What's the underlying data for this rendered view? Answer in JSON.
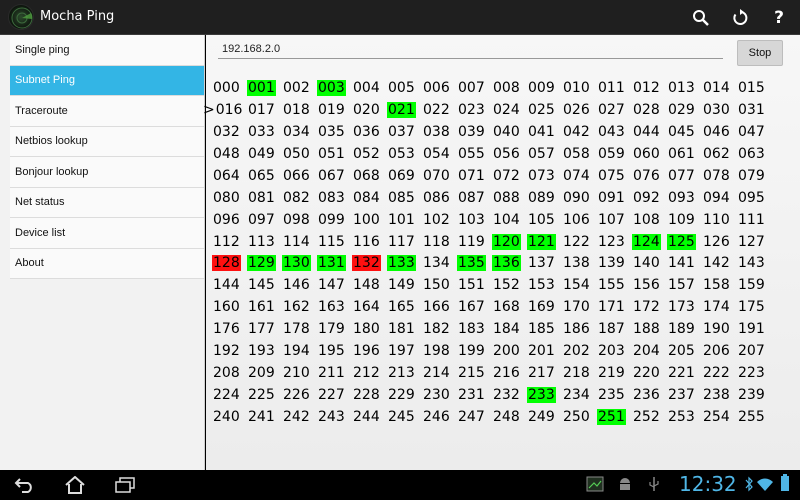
{
  "app": {
    "title": "Mocha Ping",
    "actions": [
      {
        "name": "search-icon"
      },
      {
        "name": "refresh-icon"
      },
      {
        "name": "help-icon",
        "label": "?"
      }
    ]
  },
  "sidebar": {
    "items": [
      {
        "label": "Single ping",
        "selected": false
      },
      {
        "label": "Subnet Ping",
        "selected": true
      },
      {
        "label": "Traceroute",
        "selected": false
      },
      {
        "label": "Netbios lookup",
        "selected": false
      },
      {
        "label": "Bonjour lookup",
        "selected": false
      },
      {
        "label": "Net status",
        "selected": false
      },
      {
        "label": "Device list",
        "selected": false
      },
      {
        "label": "About",
        "selected": false
      }
    ]
  },
  "main": {
    "ip_value": "192.168.2.0",
    "stop_label": "Stop",
    "current_marker": ">",
    "current_host": 16,
    "up_hosts": [
      1,
      3,
      21,
      120,
      121,
      124,
      125,
      129,
      130,
      131,
      133,
      135,
      136,
      233,
      251
    ],
    "down_hosts": [
      128,
      132
    ],
    "host_count": 256
  },
  "statusbar": {
    "clock": "12:32",
    "colors": {
      "accent": "#33b5e5",
      "up": "#00ff00",
      "down": "#ff1010",
      "clock": "#4fb6e6"
    }
  }
}
